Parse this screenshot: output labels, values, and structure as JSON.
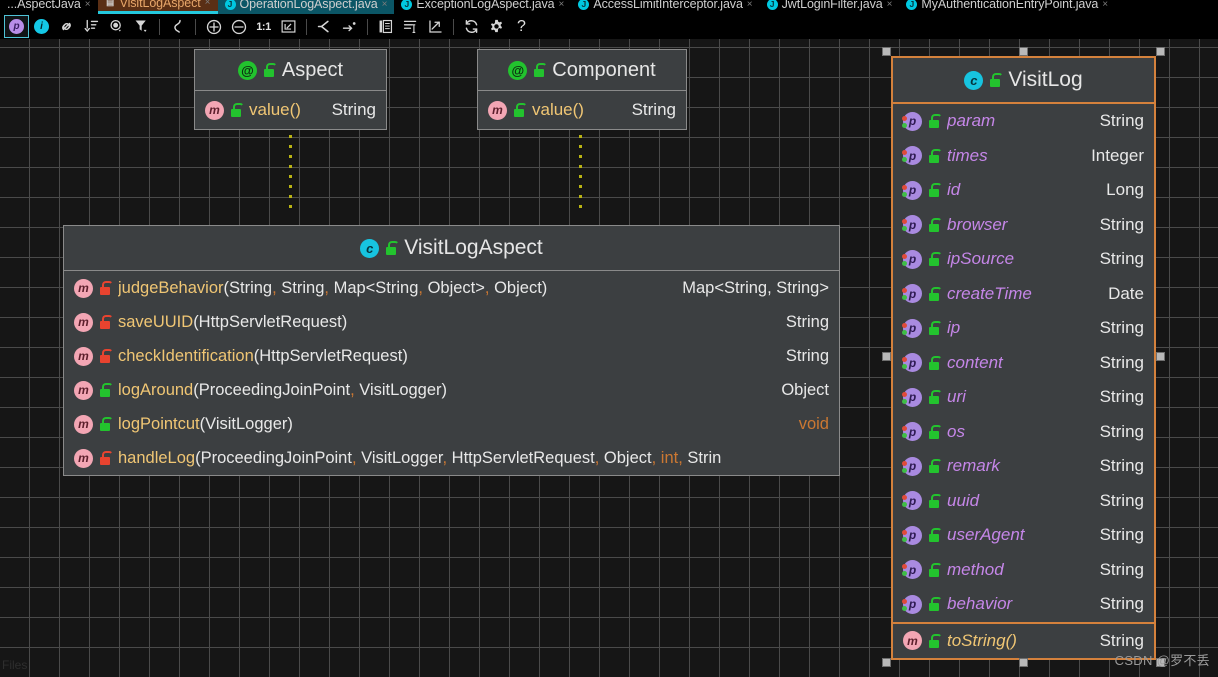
{
  "tabs": [
    {
      "label": "...AspectJava",
      "icon": "java-file-icon",
      "state": "plain",
      "close": "×"
    },
    {
      "label": "VisitLogAspect",
      "icon": "uml-diagram-icon",
      "state": "active",
      "close": "×"
    },
    {
      "label": "OperationLogAspect.java",
      "icon": "java-file-icon",
      "state": "cyan",
      "close": "×"
    },
    {
      "label": "ExceptionLogAspect.java",
      "icon": "java-file-icon",
      "state": "plain",
      "close": "×"
    },
    {
      "label": "AccessLimitInterceptor.java",
      "icon": "java-file-icon",
      "state": "plain",
      "close": "×"
    },
    {
      "label": "JwtLoginFilter.java",
      "icon": "java-file-icon",
      "state": "plain",
      "close": "×"
    },
    {
      "label": "MyAuthenticationEntryPoint.java",
      "icon": "java-file-icon",
      "state": "plain",
      "close": "×"
    }
  ],
  "toolbar": {
    "items": [
      {
        "name": "show-packages-toggle",
        "glyph": "p",
        "kind": "badge-p",
        "selected": true
      },
      {
        "name": "show-fields-toggle",
        "glyph": "i",
        "kind": "badge-i",
        "selected": false
      },
      {
        "name": "show-dependencies-icon",
        "glyph": "🔗",
        "kind": "svg-link",
        "selected": false
      },
      {
        "name": "sort-icon",
        "glyph": "↓",
        "kind": "svg-sort",
        "selected": false
      },
      {
        "name": "visibility-icon",
        "glyph": "◉",
        "kind": "svg-eye",
        "selected": false
      },
      {
        "name": "filter-icon",
        "glyph": "▼",
        "kind": "svg-filter",
        "selected": false
      },
      {
        "name": "separator-1",
        "kind": "sep"
      },
      {
        "name": "edge-style-icon",
        "glyph": "⤷",
        "kind": "svg-edge",
        "selected": false
      },
      {
        "name": "separator-2",
        "kind": "sep"
      },
      {
        "name": "zoom-in-button",
        "glyph": "+",
        "kind": "svg-plus",
        "selected": false
      },
      {
        "name": "zoom-out-button",
        "glyph": "−",
        "kind": "svg-minus",
        "selected": false
      },
      {
        "name": "actual-size-button",
        "glyph": "1:1",
        "kind": "text",
        "selected": false
      },
      {
        "name": "fit-content-button",
        "glyph": "⛶",
        "kind": "svg-fit",
        "selected": false
      },
      {
        "name": "separator-3",
        "kind": "sep"
      },
      {
        "name": "expand-nodes-icon",
        "glyph": "≺",
        "kind": "svg-expand",
        "selected": false
      },
      {
        "name": "jump-to-icon",
        "glyph": "→",
        "kind": "svg-jump",
        "selected": false
      },
      {
        "name": "separator-4",
        "kind": "sep"
      },
      {
        "name": "copy-icon",
        "glyph": "❐",
        "kind": "svg-copy",
        "selected": false
      },
      {
        "name": "layout-icon",
        "glyph": "≡",
        "kind": "svg-layout",
        "selected": false
      },
      {
        "name": "export-icon",
        "glyph": "↗",
        "kind": "svg-export",
        "selected": false
      },
      {
        "name": "separator-5",
        "kind": "sep"
      },
      {
        "name": "refresh-icon",
        "glyph": "↻",
        "kind": "svg-refresh",
        "selected": false
      },
      {
        "name": "settings-gear-icon",
        "glyph": "⚙",
        "kind": "svg-gear",
        "selected": false
      },
      {
        "name": "help-icon",
        "glyph": "?",
        "kind": "qm",
        "selected": false
      }
    ]
  },
  "canvas": {
    "files_label": "Files",
    "watermark": "CSDN @罗不丢"
  },
  "classes": {
    "aspect": {
      "title": "Aspect",
      "stereotype_icon": "annotation-icon",
      "visibility_icon": "public-lock-icon",
      "members": [
        {
          "icon": "method-icon",
          "lock": "green",
          "name": "value()",
          "params": "",
          "ret": "String"
        }
      ]
    },
    "component": {
      "title": "Component",
      "stereotype_icon": "annotation-icon",
      "visibility_icon": "public-lock-icon",
      "members": [
        {
          "icon": "method-icon",
          "lock": "green",
          "name": "value()",
          "params": "",
          "ret": "String"
        }
      ]
    },
    "visitlogaspect": {
      "title": "VisitLogAspect",
      "stereotype_icon": "class-icon",
      "visibility_icon": "public-lock-icon",
      "members": [
        {
          "icon": "method-icon",
          "lock": "red",
          "name": "judgeBehavior",
          "params": "(String, String, Map<String, Object>, Object)",
          "ret": "Map<String, String>"
        },
        {
          "icon": "method-icon",
          "lock": "red",
          "name": "saveUUID ",
          "params": "(HttpServletRequest)",
          "ret": "String"
        },
        {
          "icon": "method-icon",
          "lock": "red",
          "name": "checkIdentification",
          "params": "(HttpServletRequest)",
          "ret": "String"
        },
        {
          "icon": "method-icon",
          "lock": "green",
          "name": "logAround",
          "params": "(ProceedingJoinPoint, VisitLogger)",
          "ret": "Object"
        },
        {
          "icon": "method-icon",
          "lock": "green",
          "name": "logPointcut",
          "params": "(VisitLogger)",
          "ret": "void",
          "ret_keyword": true
        },
        {
          "icon": "method-icon",
          "lock": "red",
          "name": "handleLog",
          "params": "(ProceedingJoinPoint, VisitLogger, HttpServletRequest, Object, int, Strin",
          "ret": ""
        }
      ]
    },
    "visitlog": {
      "title": "VisitLog",
      "stereotype_icon": "class-icon",
      "visibility_icon": "public-lock-icon",
      "selected": true,
      "fields": [
        {
          "icon": "property-icon",
          "lock": "green",
          "name": "param",
          "ret": "String"
        },
        {
          "icon": "property-icon",
          "lock": "green",
          "name": "times",
          "ret": "Integer"
        },
        {
          "icon": "property-icon",
          "lock": "green",
          "name": "id",
          "ret": "Long"
        },
        {
          "icon": "property-icon",
          "lock": "green",
          "name": "browser",
          "ret": "String"
        },
        {
          "icon": "property-icon",
          "lock": "green",
          "name": "ipSource",
          "ret": "String"
        },
        {
          "icon": "property-icon",
          "lock": "green",
          "name": "createTime",
          "ret": "Date"
        },
        {
          "icon": "property-icon",
          "lock": "green",
          "name": "ip",
          "ret": "String"
        },
        {
          "icon": "property-icon",
          "lock": "green",
          "name": "content",
          "ret": "String"
        },
        {
          "icon": "property-icon",
          "lock": "green",
          "name": "uri",
          "ret": "String"
        },
        {
          "icon": "property-icon",
          "lock": "green",
          "name": "os",
          "ret": "String"
        },
        {
          "icon": "property-icon",
          "lock": "green",
          "name": "remark",
          "ret": "String"
        },
        {
          "icon": "property-icon",
          "lock": "green",
          "name": "uuid",
          "ret": "String"
        },
        {
          "icon": "property-icon",
          "lock": "green",
          "name": "userAgent",
          "ret": "String"
        },
        {
          "icon": "property-icon",
          "lock": "green",
          "name": "method",
          "ret": "String"
        },
        {
          "icon": "property-icon",
          "lock": "green",
          "name": "behavior",
          "ret": "String"
        }
      ],
      "methods": [
        {
          "icon": "method-icon",
          "lock": "green",
          "name": "toString()",
          "ret": "String"
        }
      ]
    }
  }
}
